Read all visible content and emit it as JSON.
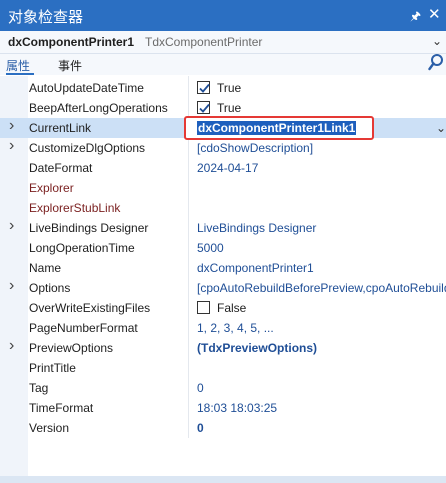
{
  "titlebar": {
    "title": "对象检查器",
    "pin_glyph": "🖈",
    "close_glyph": "✕"
  },
  "component": {
    "name": "dxComponentPrinter1",
    "type": "TdxComponentPrinter"
  },
  "tabs": [
    {
      "label": "属性",
      "active": true
    },
    {
      "label": "事件",
      "active": false
    }
  ],
  "properties": [
    {
      "name": "AutoUpdateDateTime",
      "expandable": false,
      "checkbox": true,
      "checked": true,
      "value": "True"
    },
    {
      "name": "BeepAfterLongOperations",
      "expandable": false,
      "checkbox": true,
      "checked": true,
      "value": "True"
    },
    {
      "name": "CurrentLink",
      "expandable": true,
      "selected": true,
      "value": "dxComponentPrinter1Link1"
    },
    {
      "name": "CustomizeDlgOptions",
      "expandable": true,
      "value": "[cdoShowDescription]"
    },
    {
      "name": "DateFormat",
      "expandable": false,
      "value": "2024-04-17"
    },
    {
      "name": "Explorer",
      "expandable": false,
      "event": true,
      "value": ""
    },
    {
      "name": "ExplorerStubLink",
      "expandable": false,
      "event": true,
      "value": ""
    },
    {
      "name": "LiveBindings Designer",
      "expandable": true,
      "value": "LiveBindings Designer"
    },
    {
      "name": "LongOperationTime",
      "expandable": false,
      "value": "5000"
    },
    {
      "name": "Name",
      "expandable": false,
      "value": "dxComponentPrinter1"
    },
    {
      "name": "Options",
      "expandable": true,
      "value": "[cpoAutoRebuildBeforePreview,cpoAutoRebuildB"
    },
    {
      "name": "OverWriteExistingFiles",
      "expandable": false,
      "checkbox": true,
      "checked": false,
      "value": "False"
    },
    {
      "name": "PageNumberFormat",
      "expandable": false,
      "value": "1, 2, 3, 4, 5, ..."
    },
    {
      "name": "PreviewOptions",
      "expandable": true,
      "bold": true,
      "value": "(TdxPreviewOptions)"
    },
    {
      "name": "PrintTitle",
      "expandable": false,
      "value": ""
    },
    {
      "name": "Tag",
      "expandable": false,
      "value": "0"
    },
    {
      "name": "TimeFormat",
      "expandable": false,
      "value": "18:03 18:03:25"
    },
    {
      "name": "Version",
      "expandable": false,
      "bold": true,
      "value": "0"
    }
  ],
  "colors": {
    "titlebar": "#2b6fc2",
    "selected_row": "#cce0f6",
    "highlight_border": "#e53935",
    "value_text": "#1f4e96"
  }
}
